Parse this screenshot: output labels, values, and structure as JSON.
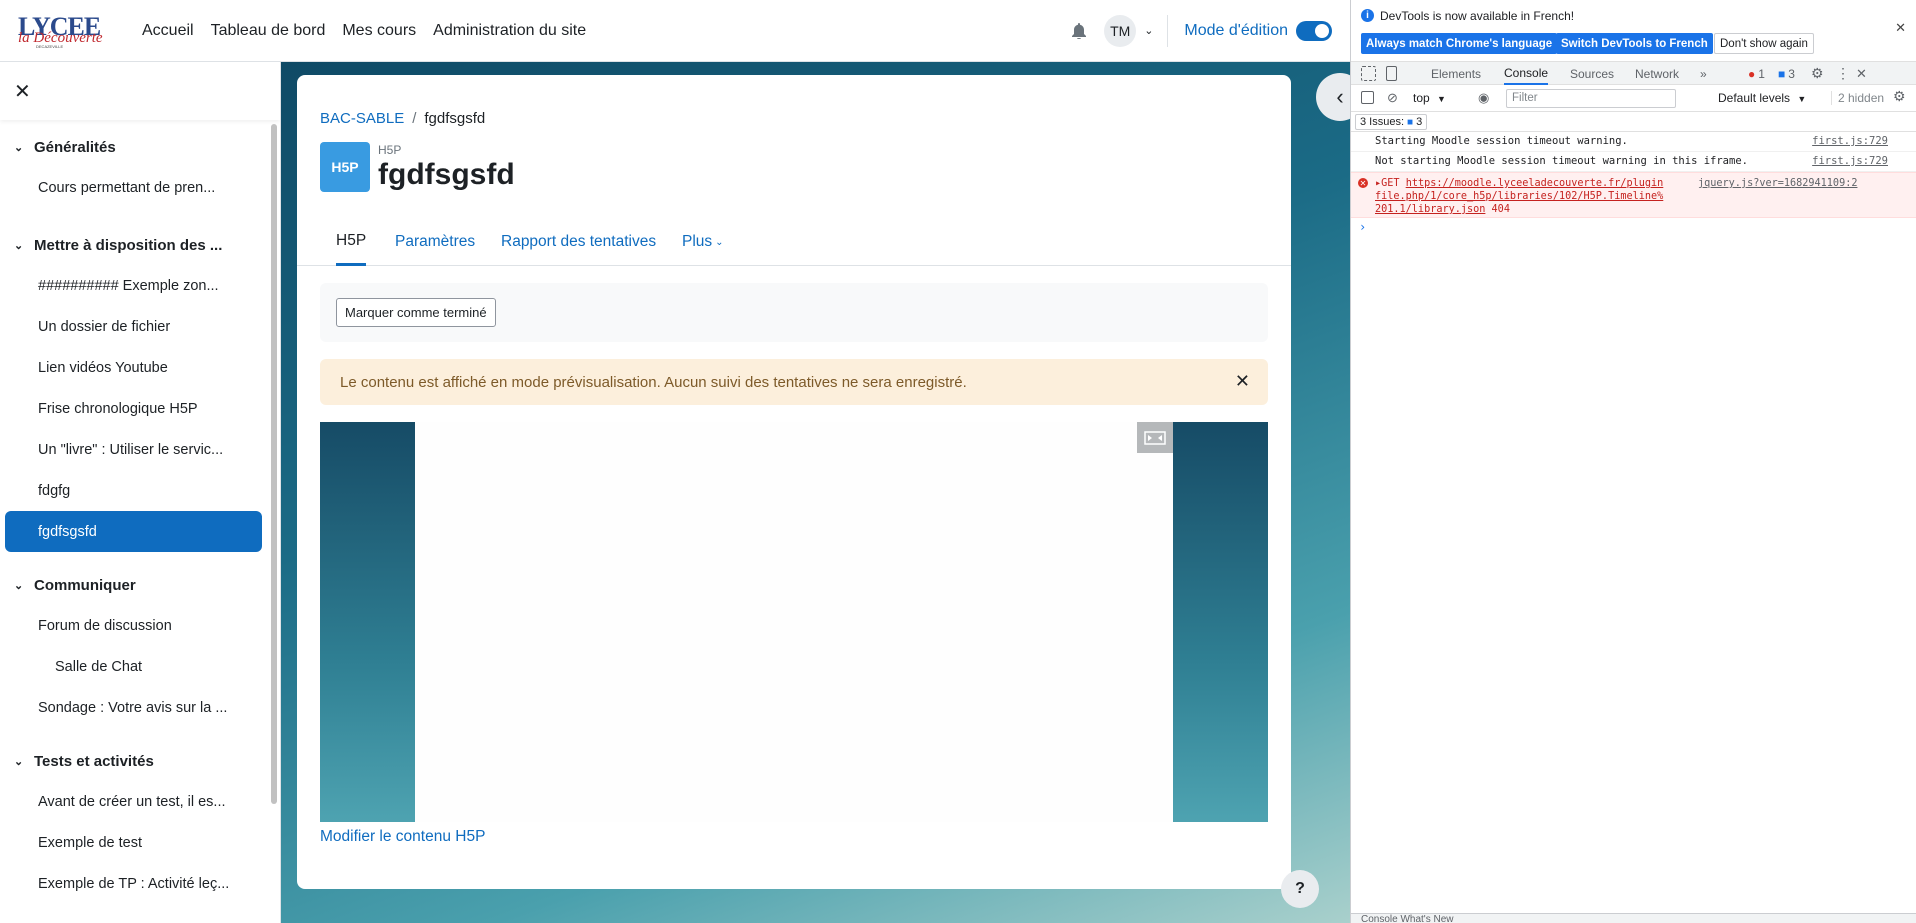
{
  "navbar": {
    "logo": {
      "line1": "LYCEE",
      "line2": "la Découverte",
      "line3": "DECAZEVILLE"
    },
    "links": [
      "Accueil",
      "Tableau de bord",
      "Mes cours",
      "Administration du site"
    ],
    "user_initials": "TM",
    "edit_mode_label": "Mode d'édition"
  },
  "drawer": {
    "sections": [
      {
        "title": "Généralités",
        "items": [
          "Cours permettant de pren..."
        ]
      },
      {
        "title": "Mettre à disposition des ...",
        "items": [
          "########## Exemple zon...",
          "Un dossier de fichier",
          "Lien vidéos Youtube",
          "Frise chronologique H5P",
          "Un \"livre\" : Utiliser le servic...",
          "fdgfg",
          "fgdfsgsfd"
        ]
      },
      {
        "title": "Communiquer",
        "items": [
          "Forum de discussion",
          "Salle de Chat",
          "Sondage : Votre avis sur la ..."
        ]
      },
      {
        "title": "Tests et activités",
        "items": [
          "Avant de créer un test, il es...",
          "Exemple de test",
          "Exemple de TP : Activité leç..."
        ]
      }
    ]
  },
  "breadcrumb": {
    "course": "BAC-SABLE",
    "separator": "/",
    "current": "fgdfsgsfd"
  },
  "activity": {
    "icon_text": "H5P",
    "type_label": "H5P",
    "title": "fgdfsgsfd"
  },
  "tabs": [
    "H5P",
    "Paramètres",
    "Rapport des tentatives",
    "Plus"
  ],
  "completion_button": "Marquer comme terminé",
  "alert_text": "Le contenu est affiché en mode prévisualisation. Aucun suivi des tentatives ne sera enregistré.",
  "edit_h5p_link": "Modifier le contenu H5P",
  "help_label": "?",
  "devtools": {
    "info_message": "DevTools is now available in French!",
    "btn_match": "Always match Chrome's language",
    "btn_switch": "Switch DevTools to French",
    "btn_dont_show": "Don't show again",
    "tabs": [
      "Elements",
      "Console",
      "Sources",
      "Network"
    ],
    "error_count": "1",
    "message_count": "3",
    "context": "top",
    "filter_placeholder": "Filter",
    "levels": "Default levels",
    "hidden": "2 hidden",
    "issues_label": "3 Issues:",
    "issues_count": "3",
    "logs": [
      {
        "text": "Starting Moodle session timeout warning.",
        "source": "first.js:729"
      },
      {
        "text": "Not starting Moodle session timeout warning in this iframe.",
        "source": "first.js:729"
      }
    ],
    "error": {
      "method": "GET",
      "url_line1": "https://moodle.lyceeladecouverte.fr/plugin",
      "url_line2": "file.php/1/core_h5p/libraries/102/H5P.Timeline%",
      "url_line3": "201.1/library.json",
      "status": "404",
      "source": "jquery.js?ver=1682941109:2"
    },
    "bottom_text": "Console   What's New"
  },
  "colors": {
    "brand": "#0f6cbf",
    "alert_bg": "#fcefdc",
    "h5p_blue": "#399be1",
    "devtools_blue": "#1a73e8"
  }
}
